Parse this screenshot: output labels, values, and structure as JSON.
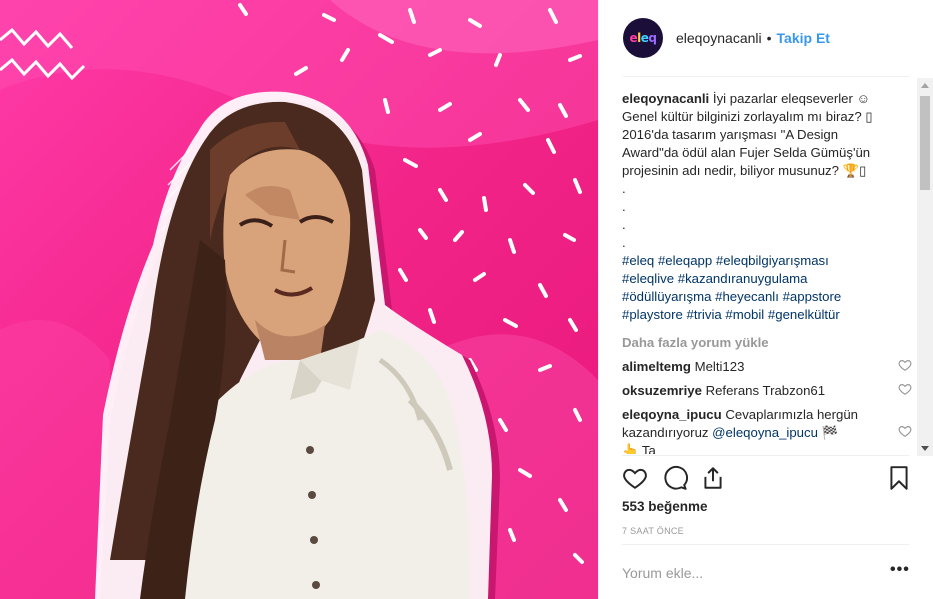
{
  "post": {
    "author": "eleqoynacanli",
    "avatar_text": [
      "e",
      "l",
      "e",
      "q"
    ],
    "follow_label": "Takip Et",
    "separator": "•"
  },
  "caption": {
    "user": "eleqoynacanli",
    "lines": [
      "İyi pazarlar eleqseverler ☺",
      "Genel kültür bilginizi zorlayalım mı biraz? ▯",
      "2016'da tasarım yarışması \"A Design",
      "Award\"da ödül alan Fujer Selda Gümüş'ün",
      "projesinin adı nedir, biliyor musunuz? 🏆▯",
      ".",
      ".",
      ".",
      "."
    ],
    "hashtags": [
      "#eleq",
      "#eleqapp",
      "#eleqbilgiyarışması",
      "#eleqlive",
      "#kazandıranuygulama",
      "#ödüllüyarışma",
      "#heyecanlı",
      "#appstore",
      "#playstore",
      "#trivia",
      "#mobil",
      "#genelkültür"
    ]
  },
  "load_more_label": "Daha fazla yorum yükle",
  "comments": [
    {
      "user": "alimeltemg",
      "text": "Melti123"
    },
    {
      "user": "oksuzemriye",
      "text": "Referans Trabzon61"
    },
    {
      "user": "eleqoyna_ipucu",
      "text": "Cevaplarımızla hergün kazandırıyoruz",
      "mention": "@eleqoyna_ipucu",
      "tail": "🏁",
      "extra": "👆 Ta"
    }
  ],
  "icons": [
    "heart-icon",
    "comment-icon",
    "share-icon",
    "bookmark-icon",
    "more-options-icon"
  ],
  "likes_label": "553 beğenme",
  "time_label": "7 SAAT ÖNCE",
  "comment_input_placeholder": "Yorum ekle...",
  "more_label": "•••",
  "colors": {
    "accent": "#3897f0",
    "bg_pink": "#f0288c",
    "text": "#262626",
    "muted": "#999999"
  }
}
